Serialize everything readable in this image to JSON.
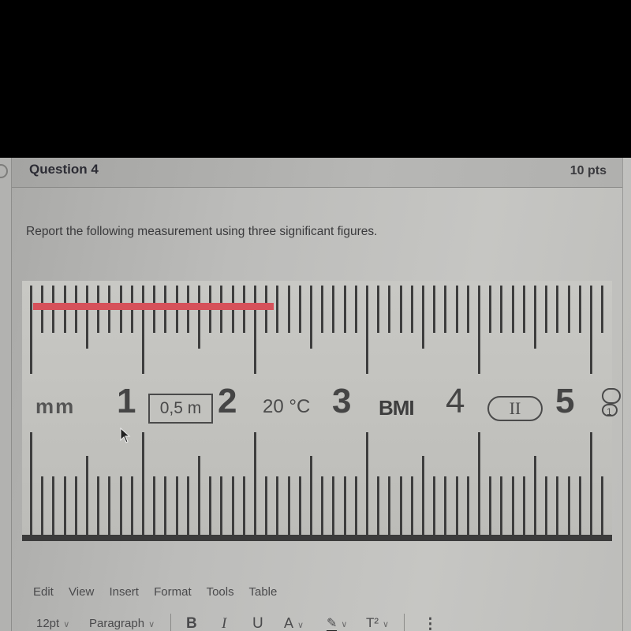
{
  "question": {
    "title": "Question 4",
    "points": "10 pts",
    "prompt": "Report the following measurement using three significant figures."
  },
  "ruler": {
    "unit_label": "mm",
    "numbers": [
      "1",
      "2",
      "3",
      "4",
      "5"
    ],
    "accuracy_box": "0,5 m",
    "temperature": "20 °C",
    "brand": "BMI",
    "class_mark": "II",
    "edge_mark": "1",
    "scale_units": "cm",
    "scale_min": 0,
    "scale_max": 5.2,
    "measured_bar": {
      "start": 0,
      "end": 2.15,
      "color": "#d6515a"
    }
  },
  "editor": {
    "menu": [
      "Edit",
      "View",
      "Insert",
      "Format",
      "Tools",
      "Table"
    ],
    "font_size": "12pt",
    "block_format": "Paragraph",
    "buttons": {
      "bold": "B",
      "italic": "I",
      "underline": "U",
      "text_color": "A",
      "highlight": "✎",
      "superscript": "T²",
      "more": "⋮"
    }
  }
}
